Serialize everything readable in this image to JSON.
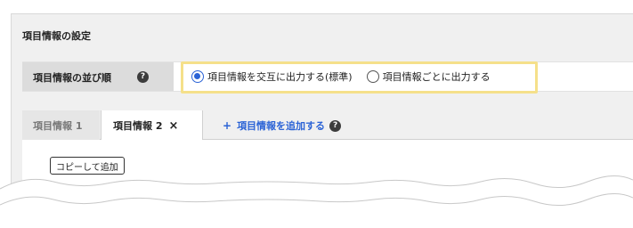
{
  "panel": {
    "title": "項目情報の設定"
  },
  "order": {
    "label": "項目情報の並び順",
    "help_icon": "?",
    "options": [
      {
        "label": "項目情報を交互に出力する(標準)",
        "checked": true
      },
      {
        "label": "項目情報ごとに出力する",
        "checked": false
      }
    ]
  },
  "tabs": [
    {
      "label": "項目情報 1",
      "active": false
    },
    {
      "label": "項目情報 2",
      "active": true,
      "close": "×"
    }
  ],
  "add_tab": {
    "plus": "+",
    "label": "項目情報を追加する",
    "help_icon": "?"
  },
  "copy_button": {
    "label": "コピーして追加"
  },
  "colors": {
    "accent": "#2b63d6",
    "highlight": "#f5e08a",
    "panel_bg": "#f0f0f0",
    "label_cell_bg": "#dcdcdc"
  }
}
